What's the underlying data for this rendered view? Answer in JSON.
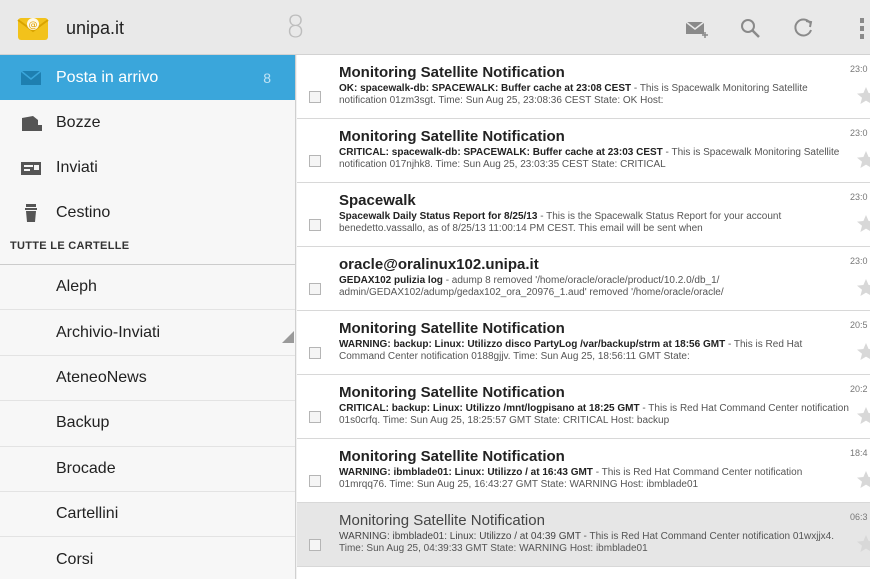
{
  "header": {
    "account": "unipa.it",
    "unread_count": "8"
  },
  "sidebar": {
    "folders": [
      {
        "label": "Posta in arrivo",
        "count": "8",
        "icon": "inbox-icon"
      },
      {
        "label": "Bozze",
        "icon": "drafts-icon"
      },
      {
        "label": "Inviati",
        "icon": "sent-icon"
      },
      {
        "label": "Cestino",
        "icon": "trash-icon"
      }
    ],
    "section_title": "TUTTE LE CARTELLE",
    "subfolders": [
      "Aleph",
      "Archivio-Inviati",
      "AteneoNews",
      "Backup",
      "Brocade",
      "Cartellini",
      "Corsi"
    ]
  },
  "messages": [
    {
      "sender": "Monitoring Satellite Notification",
      "subject": "OK: spacewalk-db: SPACEWALK: Buffer cache at 23:08 CEST",
      "snippet": " - This is Spacewalk Monitoring Satellite notification 01zm3sgt. Time: Sun Aug 25, 23:08:36 CEST State: OK Host:",
      "time": "23:0"
    },
    {
      "sender": "Monitoring Satellite Notification",
      "subject": "CRITICAL: spacewalk-db: SPACEWALK: Buffer cache at 23:03 CEST",
      "snippet": " - This is Spacewalk Monitoring Satellite notification 017njhk8. Time: Sun Aug 25, 23:03:35 CEST State: CRITICAL",
      "time": "23:0"
    },
    {
      "sender": "Spacewalk",
      "subject": "Spacewalk Daily Status Report for 8/25/13",
      "snippet": " - This is the Spacewalk Status Report for your account benedetto.vassallo, as of 8/25/13 11:00:14 PM CEST. This email will be sent when",
      "time": "23:0"
    },
    {
      "sender": "oracle@oralinux102.unipa.it",
      "subject": "GEDAX102 pulizia log",
      "snippet": " - adump 8 removed '/home/oracle/oracle/product/10.2.0/db_1/ admin/GEDAX102/adump/gedax102_ora_20976_1.aud' removed '/home/oracle/oracle/",
      "time": "23:0"
    },
    {
      "sender": "Monitoring Satellite Notification",
      "subject": "WARNING: backup: Linux: Utilizzo disco PartyLog /var/backup/strm at 18:56 GMT",
      "snippet": " - This is Red Hat Command Center notification 0188gjjv. Time: Sun Aug 25, 18:56:11 GMT State:",
      "time": "20:5"
    },
    {
      "sender": "Monitoring Satellite Notification",
      "subject": "CRITICAL: backup: Linux: Utilizzo /mnt/logpisano at 18:25 GMT",
      "snippet": " - This is Red Hat Command Center notification 01s0crfq. Time: Sun Aug 25, 18:25:57 GMT State: CRITICAL Host: backup",
      "time": "20:2"
    },
    {
      "sender": "Monitoring Satellite Notification",
      "subject": "WARNING: ibmblade01: Linux: Utilizzo / at 16:43 GMT",
      "snippet": " - This is Red Hat Command Center notification 01mrqq76. Time: Sun Aug 25, 16:43:27 GMT State: WARNING Host: ibmblade01",
      "time": "18:4"
    },
    {
      "sender": "Monitoring Satellite Notification",
      "subject": "WARNING: ibmblade01: Linux: Utilizzo / at 04:39 GMT",
      "snippet": " - This is Red Hat Command Center notification 01wxjjx4. Time: Sun Aug 25, 04:39:33 GMT State: WARNING Host: ibmblade01",
      "time": "06:3",
      "read": true
    }
  ],
  "colors": {
    "accent": "#3aa6db",
    "topbar": "#e9e9e9",
    "read_row": "#e6e6e6"
  }
}
